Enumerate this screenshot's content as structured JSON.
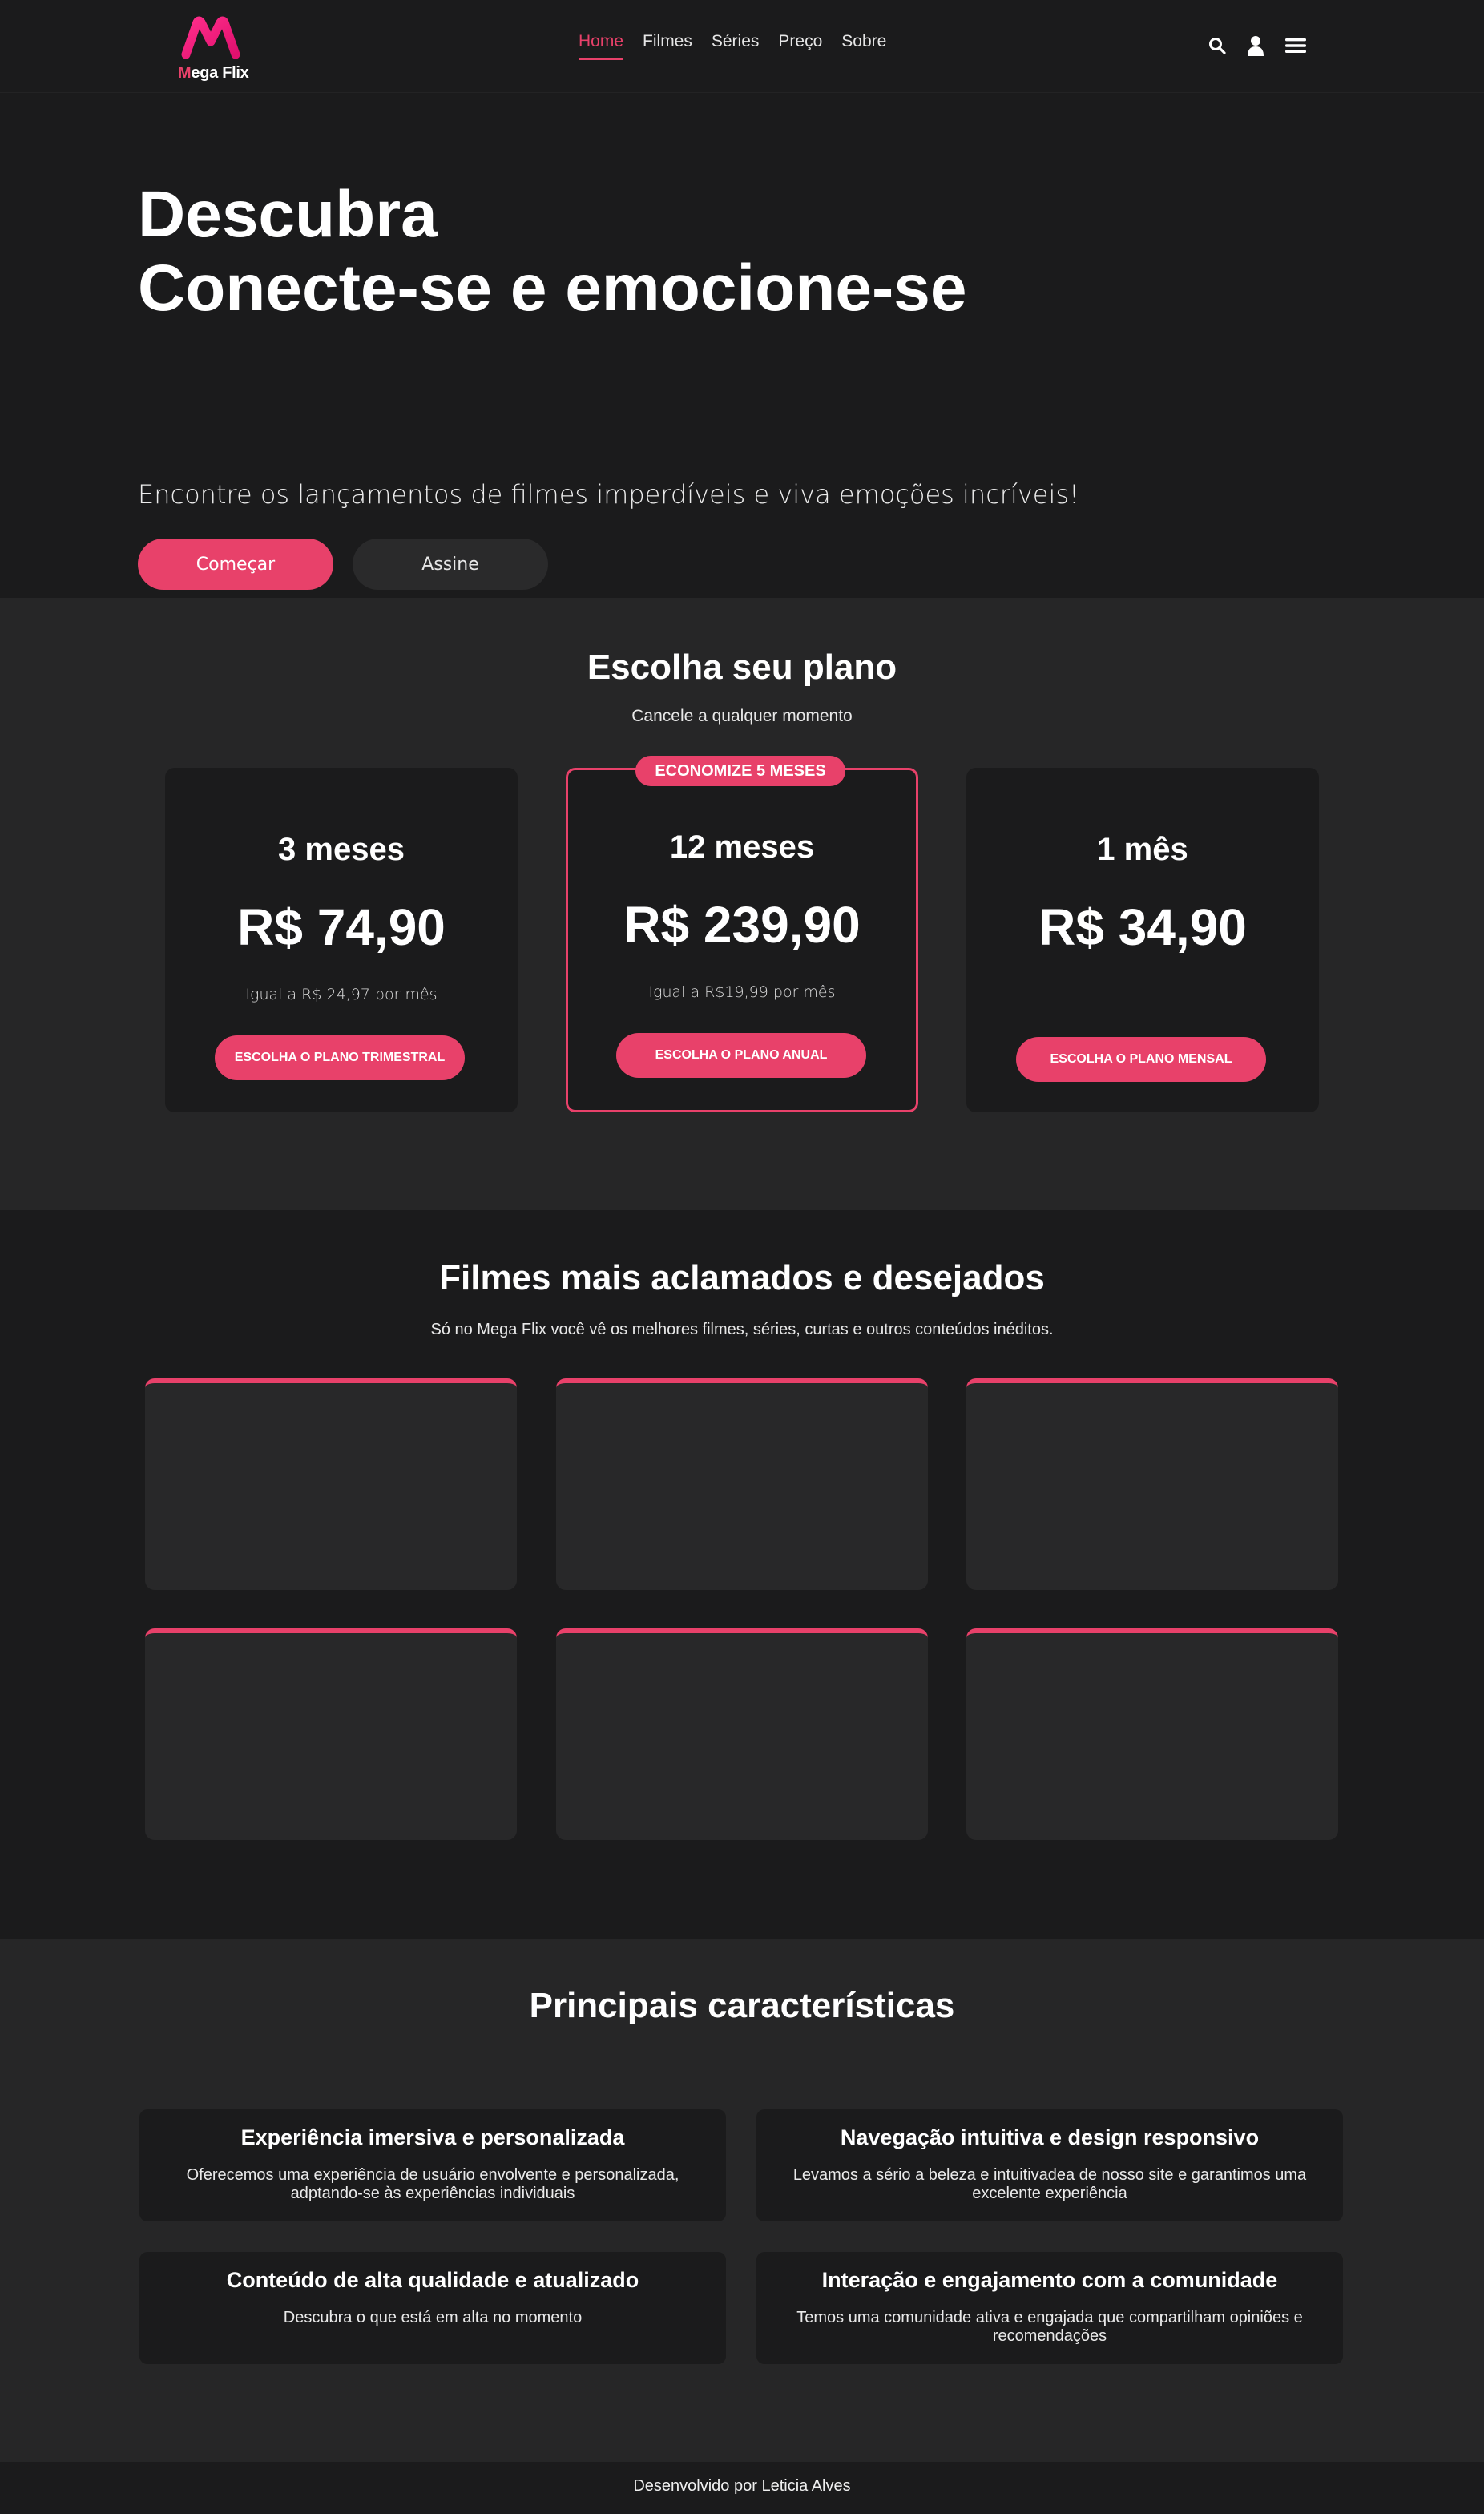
{
  "brand": {
    "logo_initial": "M",
    "logo_rest": "ega Flix",
    "accent_color": "#e8416a",
    "background_color": "#1b1b1c"
  },
  "nav": {
    "items": [
      {
        "label": "Home",
        "active": true
      },
      {
        "label": "Filmes",
        "active": false
      },
      {
        "label": "Séries",
        "active": false
      },
      {
        "label": "Preço",
        "active": false
      },
      {
        "label": "Sobre",
        "active": false
      }
    ],
    "icons": [
      "search-icon",
      "user-icon",
      "menu-icon"
    ]
  },
  "hero": {
    "title_line1": "Descubra",
    "title_line2": "Conecte-se e emocione-se",
    "subtitle": "Encontre os lançamentos de filmes imperdíveis e viva emoções incríveis!",
    "primary_button": "Começar",
    "secondary_button": "Assine"
  },
  "plans": {
    "title": "Escolha seu plano",
    "subtitle": "Cancele a qualquer momento",
    "items": [
      {
        "period": "3 meses",
        "price": "R$ 74,90",
        "note": "Igual a R$ 24,97 por mês",
        "button": "ESCOLHA O PLANO TRIMESTRAL"
      },
      {
        "badge": "ECONOMIZE 5 MESES",
        "period": "12 meses",
        "price": "R$ 239,90",
        "note": "Igual a R$19,99 por mês",
        "button": "ESCOLHA O PLANO ANUAL"
      },
      {
        "period": "1 mês",
        "price": "R$ 34,90",
        "note": "",
        "button": "ESCOLHA O PLANO MENSAL"
      }
    ]
  },
  "movies": {
    "title": "Filmes mais aclamados e desejados",
    "subtitle": "Só no Mega Flix você vê os melhores filmes, séries, curtas e outros conteúdos inéditos."
  },
  "features": {
    "title": "Principais características",
    "items": [
      {
        "title": "Experiência imersiva e personalizada",
        "text": "Oferecemos uma experiência de usuário envolvente e personalizada, adptando-se às experiências individuais"
      },
      {
        "title": "Navegação intuitiva e design responsivo",
        "text": "Levamos a sério a beleza e intuitivadea de nosso site e garantimos uma excelente experiência"
      },
      {
        "title": "Conteúdo de alta qualidade e atualizado",
        "text": "Descubra o que está em alta no momento"
      },
      {
        "title": "Interação e engajamento com a comunidade",
        "text": "Temos uma comunidade ativa e engajada que compartilham opiniões e recomendações"
      }
    ]
  },
  "footer": {
    "text": "Desenvolvido por Leticia Alves"
  }
}
